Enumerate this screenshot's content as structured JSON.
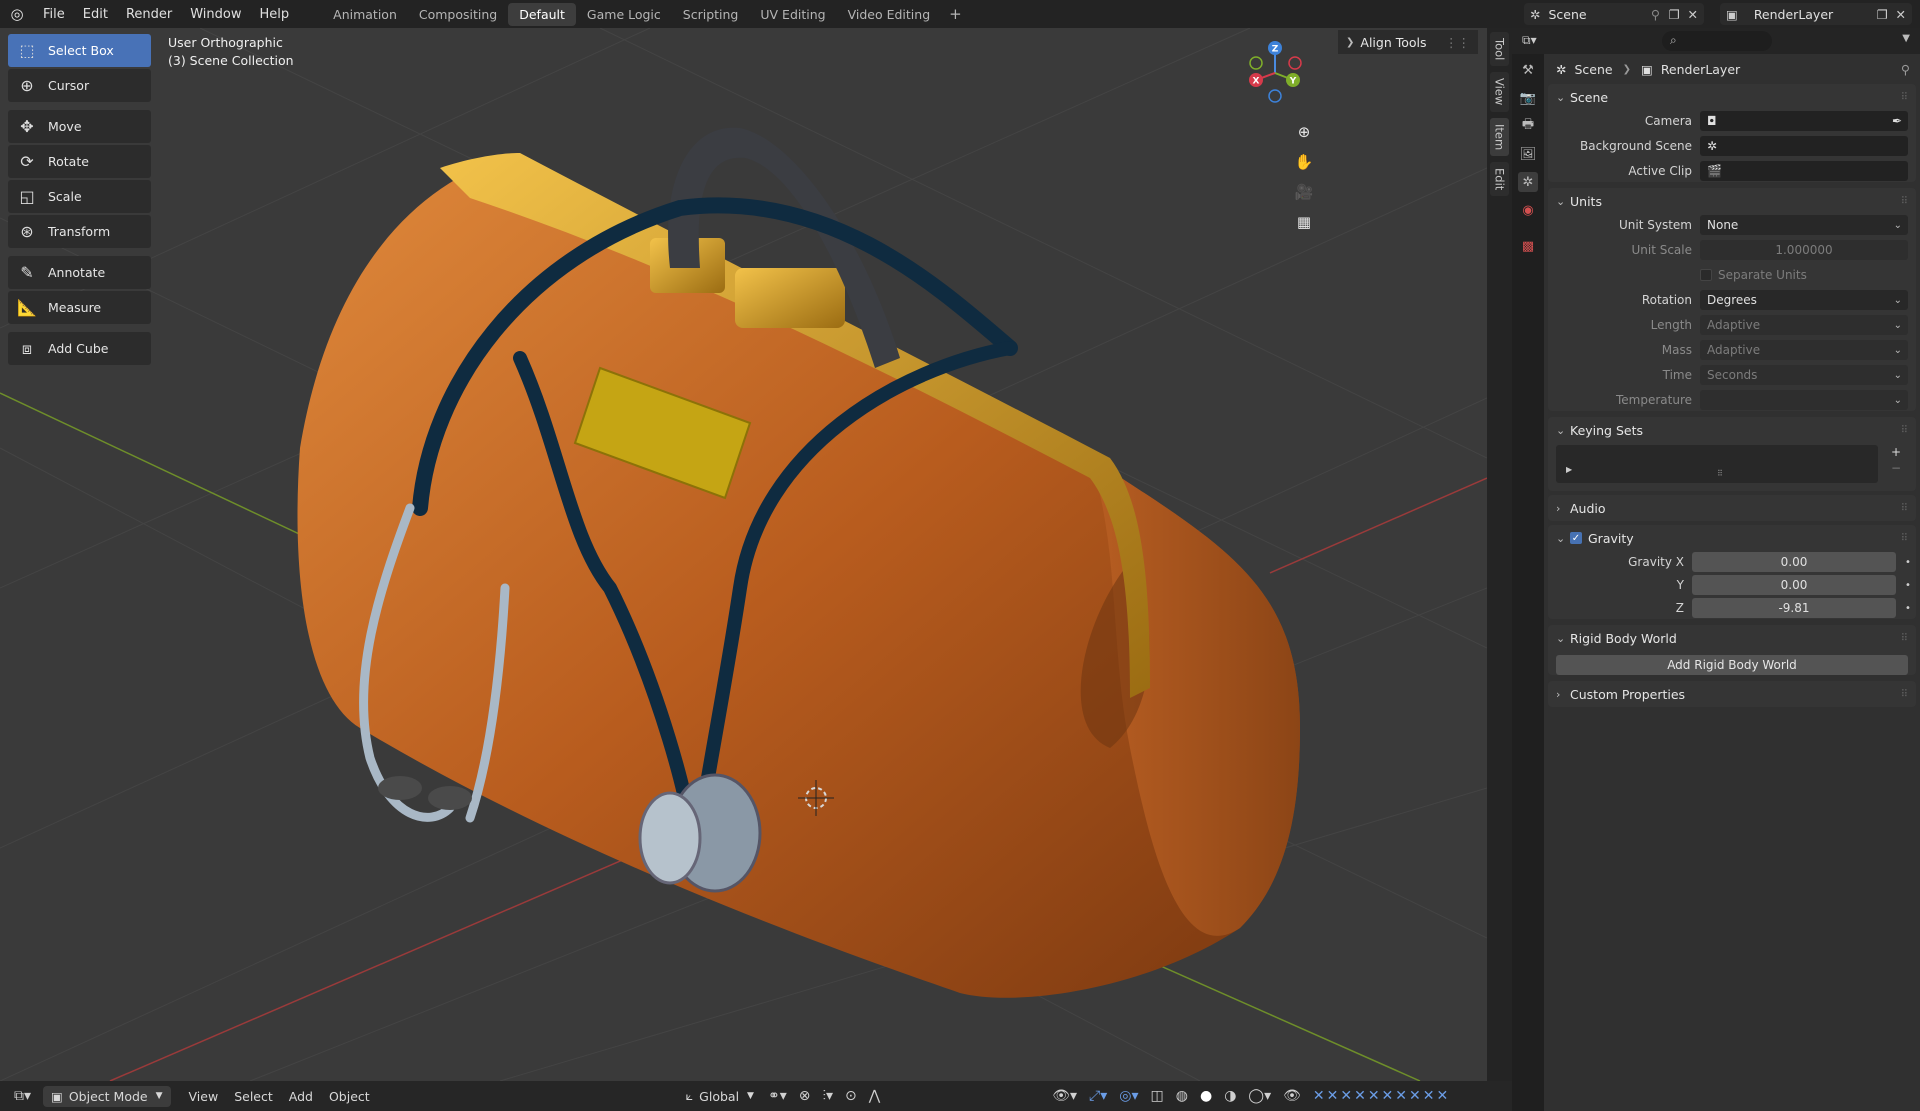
{
  "menu": [
    "File",
    "Edit",
    "Render",
    "Window",
    "Help"
  ],
  "workspaces": [
    "Animation",
    "Compositing",
    "Default",
    "Game Logic",
    "Scripting",
    "UV Editing",
    "Video Editing"
  ],
  "active_workspace": "Default",
  "scene_selector": "Scene",
  "renderlayer_selector": "RenderLayer",
  "toolbar": {
    "tools": [
      "Select Box",
      "Cursor",
      "Move",
      "Rotate",
      "Scale",
      "Transform",
      "Annotate",
      "Measure",
      "Add Cube"
    ],
    "active": "Select Box"
  },
  "viewport": {
    "view_name": "User Orthographic",
    "collection": "(3) Scene Collection",
    "sidebar_panel": "Align Tools",
    "side_tabs": [
      "Tool",
      "View",
      "Item",
      "Edit"
    ],
    "gizmo_axes": [
      "Z",
      "Y",
      "X"
    ]
  },
  "header": {
    "mode": "Object Mode",
    "menus": [
      "View",
      "Select",
      "Add",
      "Object"
    ],
    "orientation": "Global"
  },
  "properties": {
    "breadcrumb": [
      "Scene",
      "RenderLayer"
    ],
    "scene_panel": {
      "title": "Scene",
      "camera_label": "Camera",
      "background_label": "Background Scene",
      "clip_label": "Active Clip"
    },
    "units_panel": {
      "title": "Units",
      "unit_system_label": "Unit System",
      "unit_system": "None",
      "unit_scale_label": "Unit Scale",
      "unit_scale": "1.000000",
      "separate_units": "Separate Units",
      "rotation_label": "Rotation",
      "rotation": "Degrees",
      "length_label": "Length",
      "length": "Adaptive",
      "mass_label": "Mass",
      "mass": "Adaptive",
      "time_label": "Time",
      "time": "Seconds",
      "temperature_label": "Temperature"
    },
    "keying_panel": {
      "title": "Keying Sets"
    },
    "audio_panel": {
      "title": "Audio"
    },
    "gravity_panel": {
      "title": "Gravity",
      "x_label": "Gravity X",
      "x": "0.00",
      "y_label": "Y",
      "y": "0.00",
      "z_label": "Z",
      "z": "-9.81"
    },
    "rigid_panel": {
      "title": "Rigid Body World",
      "button": "Add Rigid Body World"
    },
    "custom_panel": {
      "title": "Custom Properties"
    }
  }
}
